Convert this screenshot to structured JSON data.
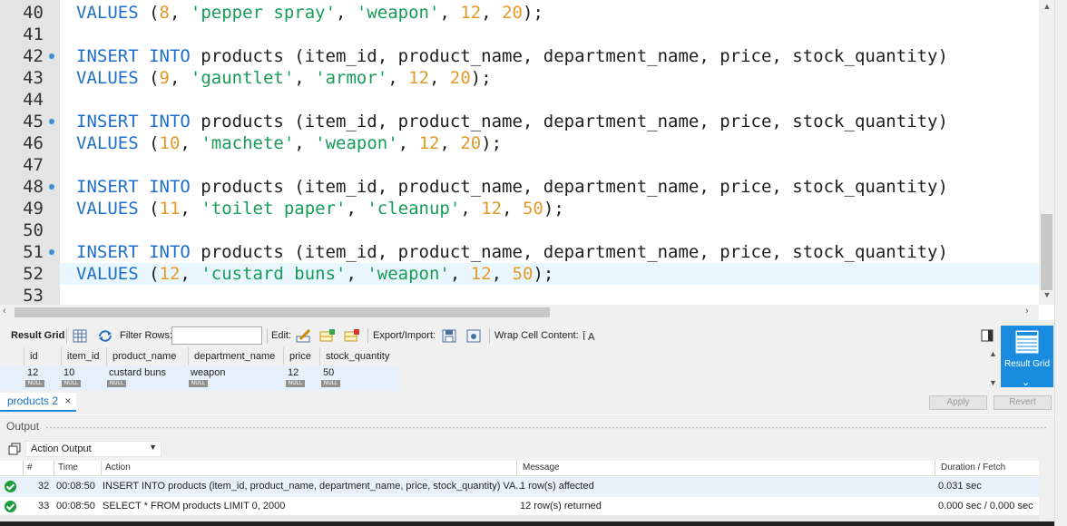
{
  "editor": {
    "lines": [
      {
        "num": "40",
        "marker": false,
        "tokens": [
          [
            "kw",
            "VALUES"
          ],
          [
            "t",
            " ("
          ],
          [
            "num",
            "8"
          ],
          [
            "t",
            ", "
          ],
          [
            "str",
            "'pepper spray'"
          ],
          [
            "t",
            ", "
          ],
          [
            "str",
            "'weapon'"
          ],
          [
            "t",
            ", "
          ],
          [
            "num",
            "12"
          ],
          [
            "t",
            ", "
          ],
          [
            "num",
            "20"
          ],
          [
            "t",
            ");"
          ]
        ]
      },
      {
        "num": "41",
        "marker": false,
        "tokens": []
      },
      {
        "num": "42",
        "marker": true,
        "tokens": [
          [
            "kw",
            "INSERT INTO"
          ],
          [
            "t",
            " products (item_id, product_name, department_name, price, stock_quantity)"
          ]
        ]
      },
      {
        "num": "43",
        "marker": false,
        "tokens": [
          [
            "kw",
            "VALUES"
          ],
          [
            "t",
            " ("
          ],
          [
            "num",
            "9"
          ],
          [
            "t",
            ", "
          ],
          [
            "str",
            "'gauntlet'"
          ],
          [
            "t",
            ", "
          ],
          [
            "str",
            "'armor'"
          ],
          [
            "t",
            ", "
          ],
          [
            "num",
            "12"
          ],
          [
            "t",
            ", "
          ],
          [
            "num",
            "20"
          ],
          [
            "t",
            ");"
          ]
        ]
      },
      {
        "num": "44",
        "marker": false,
        "tokens": []
      },
      {
        "num": "45",
        "marker": true,
        "tokens": [
          [
            "kw",
            "INSERT INTO"
          ],
          [
            "t",
            " products (item_id, product_name, department_name, price, stock_quantity)"
          ]
        ]
      },
      {
        "num": "46",
        "marker": false,
        "tokens": [
          [
            "kw",
            "VALUES"
          ],
          [
            "t",
            " ("
          ],
          [
            "num",
            "10"
          ],
          [
            "t",
            ", "
          ],
          [
            "str",
            "'machete'"
          ],
          [
            "t",
            ", "
          ],
          [
            "str",
            "'weapon'"
          ],
          [
            "t",
            ", "
          ],
          [
            "num",
            "12"
          ],
          [
            "t",
            ", "
          ],
          [
            "num",
            "20"
          ],
          [
            "t",
            ");"
          ]
        ]
      },
      {
        "num": "47",
        "marker": false,
        "tokens": []
      },
      {
        "num": "48",
        "marker": true,
        "tokens": [
          [
            "kw",
            "INSERT INTO"
          ],
          [
            "t",
            " products (item_id, product_name, department_name, price, stock_quantity)"
          ]
        ]
      },
      {
        "num": "49",
        "marker": false,
        "tokens": [
          [
            "kw",
            "VALUES"
          ],
          [
            "t",
            " ("
          ],
          [
            "num",
            "11"
          ],
          [
            "t",
            ", "
          ],
          [
            "str",
            "'toilet paper'"
          ],
          [
            "t",
            ", "
          ],
          [
            "str",
            "'cleanup'"
          ],
          [
            "t",
            ", "
          ],
          [
            "num",
            "12"
          ],
          [
            "t",
            ", "
          ],
          [
            "num",
            "50"
          ],
          [
            "t",
            ");"
          ]
        ]
      },
      {
        "num": "50",
        "marker": false,
        "tokens": []
      },
      {
        "num": "51",
        "marker": true,
        "tokens": [
          [
            "kw",
            "INSERT INTO"
          ],
          [
            "t",
            " products (item_id, product_name, department_name, price, stock_quantity)"
          ]
        ]
      },
      {
        "num": "52",
        "marker": false,
        "current": true,
        "tokens": [
          [
            "kw",
            "VALUES"
          ],
          [
            "t",
            " ("
          ],
          [
            "num",
            "12"
          ],
          [
            "t",
            ", "
          ],
          [
            "str",
            "'custard buns'"
          ],
          [
            "t",
            ", "
          ],
          [
            "str",
            "'weapon'"
          ],
          [
            "t",
            ", "
          ],
          [
            "num",
            "12"
          ],
          [
            "t",
            ", "
          ],
          [
            "num",
            "50"
          ],
          [
            "t",
            ");"
          ]
        ]
      },
      {
        "num": "53",
        "marker": false,
        "tokens": []
      }
    ]
  },
  "results": {
    "toolbar": {
      "result_grid": "Result Grid",
      "filter_rows": "Filter Rows:",
      "edit": "Edit:",
      "export_import": "Export/Import:",
      "wrap_cell": "Wrap Cell Content:"
    },
    "columns": [
      "id",
      "item_id",
      "product_name",
      "department_name",
      "price",
      "stock_quantity"
    ],
    "row": [
      "12",
      "10",
      "custard buns",
      "weapon",
      "12",
      "50"
    ],
    "null_label": "NULL",
    "panel_button": "Result Grid",
    "tab_label": "products 2",
    "tab_close": "×",
    "apply": "Apply",
    "revert": "Revert"
  },
  "output": {
    "title": "Output",
    "select_value": "Action Output",
    "columns": [
      "#",
      "Time",
      "Action",
      "Message",
      "Duration / Fetch"
    ],
    "rows": [
      {
        "num": "32",
        "time": "00:08:50",
        "action": "INSERT INTO products (item_id, product_name, department_name, price, stock_quantity) VA...",
        "message": "1 row(s) affected",
        "duration": "0.031 sec"
      },
      {
        "num": "33",
        "time": "00:08:50",
        "action": "SELECT * FROM products LIMIT 0, 2000",
        "message": "12 row(s) returned",
        "duration": "0.000 sec / 0.000 sec"
      }
    ]
  },
  "colors": {
    "keyword": "#1e6fc9",
    "number": "#e39a2a",
    "string": "#179c57",
    "accent": "#1a8ce0",
    "success": "#1e9c3f"
  }
}
